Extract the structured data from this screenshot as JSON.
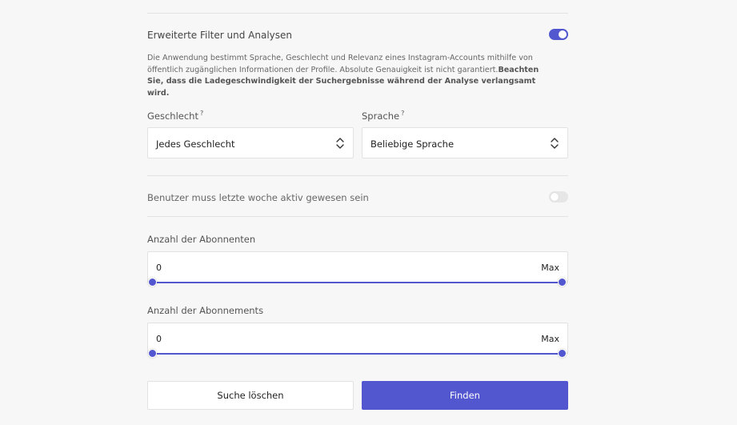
{
  "advanced": {
    "title": "Erweiterte Filter und Analysen",
    "enabled": true,
    "description_normal": "Die Anwendung bestimmt Sprache, Geschlecht und Relevanz eines Instagram-Accounts mithilfe von öffentlich zugänglichen Informationen der Profile. Absolute Genauigkeit ist nicht garantiert.",
    "description_bold": "Beachten Sie, dass die Ladegeschwindigkeit der Suchergebnisse während der Analyse verlangsamt wird."
  },
  "gender": {
    "label": "Geschlecht",
    "hint": "?",
    "value": "Jedes Geschlecht"
  },
  "language": {
    "label": "Sprache",
    "hint": "?",
    "value": "Beliebige Sprache"
  },
  "active": {
    "label": "Benutzer muss letzte woche aktiv gewesen sein",
    "enabled": false
  },
  "followers": {
    "label": "Anzahl der Abonnenten",
    "min": "0",
    "max": "Max"
  },
  "following": {
    "label": "Anzahl der Abonnements",
    "min": "0",
    "max": "Max"
  },
  "buttons": {
    "clear": "Suche löschen",
    "find": "Finden"
  },
  "colors": {
    "accent": "#5256cf"
  }
}
